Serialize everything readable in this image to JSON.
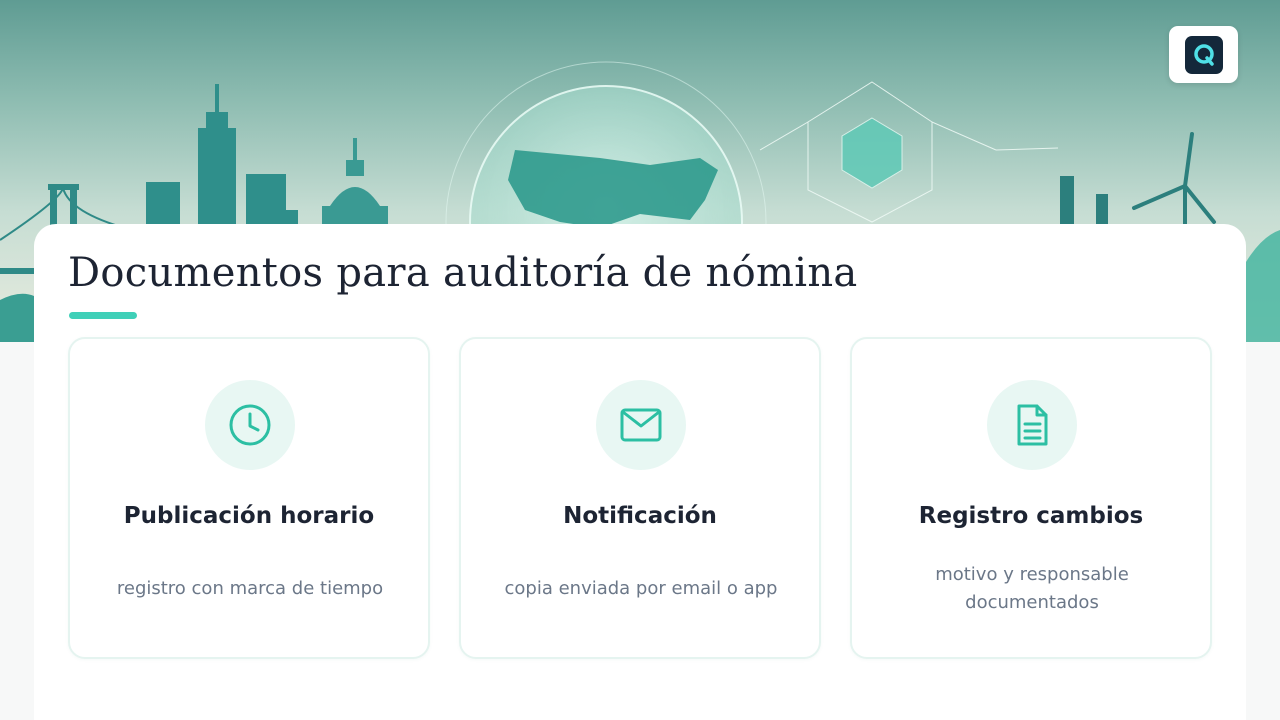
{
  "header": {
    "logo_icon": "q-logo-icon",
    "banner_motifs": [
      "golden-gate-bridge",
      "skyscrapers",
      "capitol-dome",
      "usa-map-globe",
      "network-cube",
      "factory-chimneys",
      "wind-turbine"
    ]
  },
  "page": {
    "title": "Documentos para auditoría de nómina"
  },
  "cards": [
    {
      "icon": "clock-icon",
      "title": "Publicación horario",
      "description": "registro con marca de tiempo"
    },
    {
      "icon": "envelope-icon",
      "title": "Notificación",
      "description": "copia enviada por email o app"
    },
    {
      "icon": "document-icon",
      "title": "Registro cambios",
      "description": "motivo y responsable documentados"
    }
  ],
  "colors": {
    "accent": "#3fd0b8",
    "icon_stroke": "#2cbfa3",
    "icon_bg": "#e8f7f3",
    "title_text": "#1d2433",
    "desc_text": "#6b7788",
    "logo_bg": "#14283a"
  }
}
